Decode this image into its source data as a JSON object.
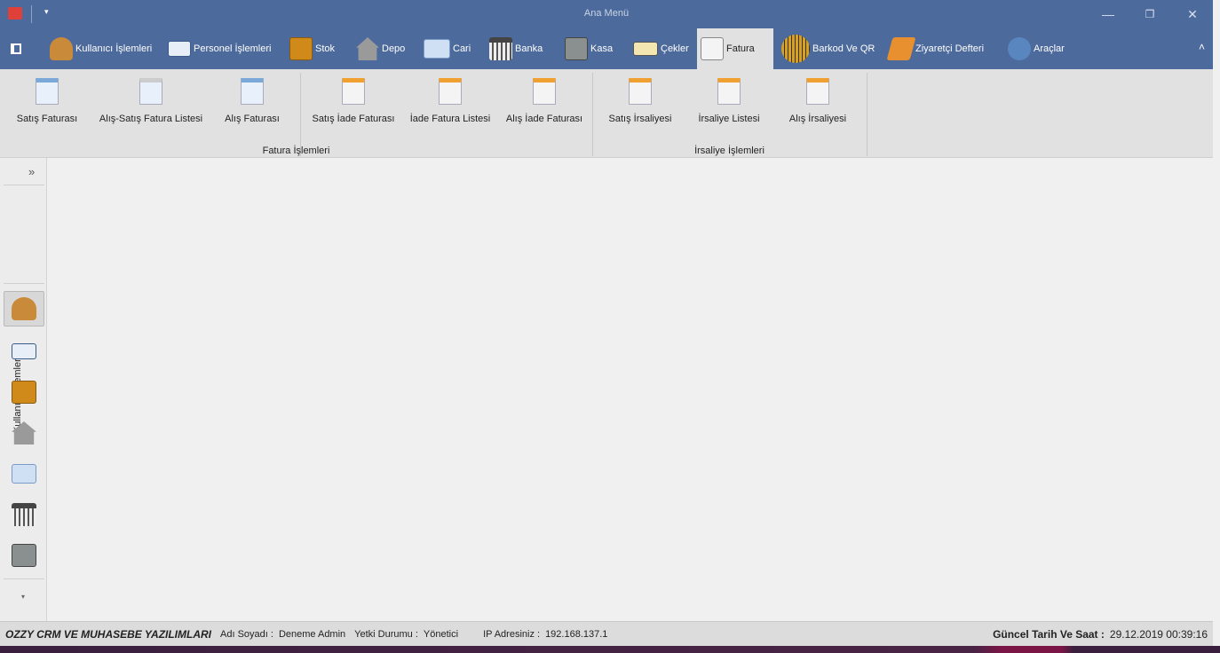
{
  "window": {
    "title": "Ana Menü",
    "minimize": "—",
    "restore": "❐",
    "close": "✕",
    "quick_access": "▾"
  },
  "tabs": [
    {
      "label": "Kullanıcı İşlemleri",
      "color": "#c98a3a"
    },
    {
      "label": "Personel İşlemleri",
      "color": "#e8eef8"
    },
    {
      "label": "Stok",
      "color": "#d08a1a"
    },
    {
      "label": "Depo",
      "color": "#9a9a9a"
    },
    {
      "label": "Cari",
      "color": "#cfe0f4"
    },
    {
      "label": "Banka",
      "color": "#dddddd"
    },
    {
      "label": "Kasa",
      "color": "#8a9090"
    },
    {
      "label": "Çekler",
      "color": "#f4e6b0"
    },
    {
      "label": "Fatura",
      "color": "#f4f4f4"
    },
    {
      "label": "Barkod Ve QR",
      "color": "#d8a020"
    },
    {
      "label": "Ziyaretçi Defteri",
      "color": "#e89030"
    },
    {
      "label": "Araçlar",
      "color": "#5a86c0"
    }
  ],
  "ribbon": {
    "groups": [
      {
        "label": "Fatura İşlemleri",
        "buttons": [
          "Satış Faturası",
          "Alış-Satış Fatura Listesi",
          "Alış Faturası",
          "Satış İade Faturası",
          "İade Fatura Listesi",
          "Alış İade Faturası"
        ]
      },
      {
        "label": "İrsaliye İşlemleri",
        "buttons": [
          "Satış İrsaliyesi",
          "İrsaliye Listesi",
          "Alış İrsaliyesi"
        ]
      }
    ],
    "collapse": "˄"
  },
  "nav": {
    "expand": "»",
    "header": "Kullanıcı İşlemleri",
    "more": "▾"
  },
  "status": {
    "brand": "OZZY CRM VE MUHASEBE YAZILIMLARI",
    "name_label": "Adı Soyadı :",
    "name": "Deneme Admin",
    "role_label": "Yetki Durumu :",
    "role": "Yönetici",
    "ip_label": "IP Adresiniz :",
    "ip": "192.168.137.1",
    "datetime_label": "Güncel Tarih Ve Saat :",
    "datetime": "29.12.2019 00:39:16"
  }
}
